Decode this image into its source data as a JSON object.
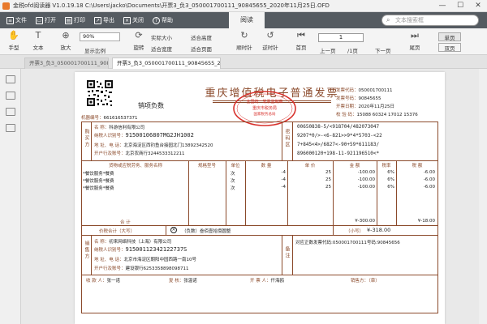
{
  "window": {
    "title": "金税ofd阅读器 V1.0.19.18  C:\\Users\\jacko\\Documents\\开票3_负3_050001700111_90845655_2020年11月25日.OFD",
    "minimize": "—",
    "maximize": "☐",
    "close": "✕"
  },
  "menu": {
    "file": "文件",
    "open": "打开",
    "print": "打印",
    "export": "导出",
    "close": "关闭",
    "help": "帮助",
    "read_tab": "阅读",
    "search_placeholder": "文本搜索框"
  },
  "toolbar": {
    "hand": "手型",
    "text": "文本",
    "zoom_in": "放大",
    "show_ratio": "显示比例",
    "zoom_select": "90%",
    "rotate": "旋转",
    "actual_size": "实际大小",
    "fit_height": "适合高度",
    "fit_width": "适合宽度",
    "fit_page": "适合页面",
    "cw": "顺时针",
    "ccw": "逆时针",
    "first_page": "首页",
    "prev_page": "上一页",
    "page_input": "1",
    "page_total": "/1页",
    "next_page": "下一页",
    "last_page": "尾页",
    "single_page": "单页",
    "double_page": "双页"
  },
  "tabs": [
    {
      "label": "开票3_负3_050001700111_90845655_2020年11月25日.OFD"
    },
    {
      "label": "开票3_负3_050001700111_90845655_2020年11月25日.OFD"
    }
  ],
  "invoice": {
    "title": "重庆增值税电子普通发票",
    "stamp_line1": "全国统一发票监制章",
    "stamp_line2": "重庆市税务局",
    "stamp_line3": "国家税务总局",
    "neg_label": "销项负数",
    "machine_no_label": "机器编号：",
    "machine_no": "661616537371",
    "code_label": "发票代码：",
    "code": "050001700111",
    "number_label": "发票号码：",
    "number": "90845655",
    "date_label": "开票日期：",
    "date": "2020年11月25日",
    "check_label": "校 验 码：",
    "check": "15088 60324 17012 15376",
    "buyer_side": "购买方",
    "seller_side": "销售方",
    "pwd_side": "密码区",
    "remark_side": "备注",
    "buyer": {
      "name_label": "名        称：",
      "name": "科游信利有限公司",
      "tax_label": "纳税人识别号：",
      "tax": "91500106807MG2JH1002",
      "addr_label": "地 址、电 话：",
      "addr": "北京海淀区西钓鱼台接园北门13892342520",
      "bank_label": "开户行及账号：",
      "bank": "北京农商行3244533312211"
    },
    "cipher": [
      "00650838-5/<918704/482073047",
      "9207*0/>-<6-821>>9*4*5703-<22",
      "7+845<4>/6827<-90+59*611183/",
      "896000120+198-11-921196510<*"
    ],
    "headers": {
      "item": "货物或应税劳务、服务名称",
      "spec": "规格型号",
      "unit": "单位",
      "qty": "数 量",
      "price": "单 价",
      "amount": "金 额",
      "rate": "税率",
      "tax": "税 额"
    },
    "items": [
      {
        "name": "*餐饮服务*餐费",
        "unit": "次",
        "qty": "-4",
        "price": "25",
        "amount": "-100.00",
        "rate": "6%",
        "tax": "-6.00"
      },
      {
        "name": "*餐饮服务*餐费",
        "unit": "次",
        "qty": "-4",
        "price": "25",
        "amount": "-100.00",
        "rate": "6%",
        "tax": "-6.00"
      },
      {
        "name": "*餐饮服务*餐费",
        "unit": "次",
        "qty": "-4",
        "price": "25",
        "amount": "-100.00",
        "rate": "6%",
        "tax": "-6.00"
      }
    ],
    "total_label": "合          计",
    "total_amount": "¥-300.00",
    "total_tax": "¥-18.00",
    "grand_label": "价税合计（大写）",
    "grand_words": "（负数）叁佰壹拾捌圆整",
    "grand_small_label": "（小写）",
    "grand_small": "¥-318.00",
    "seller": {
      "name_label": "名        称：",
      "name": "初来网络科技（上海）有限公司",
      "tax_label": "纳税人识别号：",
      "tax": "91500112342122737S",
      "addr_label": "地 址、电 话：",
      "addr": "北京市海淀区朝阳中园西路一南10号",
      "bank_label": "开户行及账号：",
      "bank": "建设银行6253358898098711"
    },
    "remark": "对应正数发票代码:050001700111号码:90845656",
    "payee_label": "收 款 人：",
    "payee": "张一诺",
    "reviewer_label": "复 核：",
    "reviewer": "张温诺",
    "drawer_label": "开 票 人：",
    "drawer": "仟海鸥",
    "seller_sign_label": "销售方：（章）"
  },
  "colors": {
    "menubar": "#555b61",
    "invoice_ink": "#8b4a2b",
    "stamp": "#d8322d"
  }
}
